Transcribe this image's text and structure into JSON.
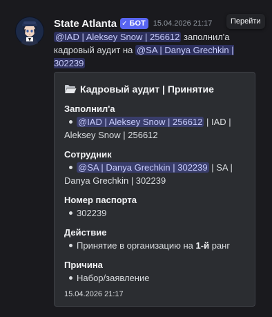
{
  "message": {
    "author": "State Atlanta",
    "bot_check": "✓",
    "bot_label": "БОТ",
    "timestamp": "15.04.2026 21:17",
    "goto_label": "Перейти",
    "mention_filler": "@IAD | Aleksey Snow | 256612",
    "text_action": "заполнил'а",
    "text_audit_prefix": "кадровый аудит на",
    "mention_target_part1": "@SA | Danya Grechkin |",
    "mention_target_part2": "302239"
  },
  "embed": {
    "icon": "open-folder-icon",
    "title": "Кадровый аудит | Принятие",
    "fields": {
      "filler": {
        "name": "Заполнил'а",
        "mention": "@IAD | Aleksey Snow | 256612",
        "rest_line1": "| IAD |",
        "rest_line2": "Aleksey Snow | 256612"
      },
      "employee": {
        "name": "Сотрудник",
        "mention": "@SA | Danya Grechkin | 302239",
        "rest_line1": "| SA |",
        "rest_line2": "Danya Grechkin | 302239"
      },
      "passport": {
        "name": "Номер паспорта",
        "value": "302239"
      },
      "action": {
        "name": "Действие",
        "value_prefix": "Принятие в организацию на",
        "value_rank": "1-й",
        "value_suffix": "ранг"
      },
      "reason": {
        "name": "Причина",
        "value": "Набор/заявление"
      }
    },
    "footer": "15.04.2026 21:17"
  },
  "colors": {
    "background": "#1a1a1e",
    "embed_background": "#2b2d31",
    "bot_tag": "#5865f2",
    "mention_text": "#c9cdfb"
  }
}
